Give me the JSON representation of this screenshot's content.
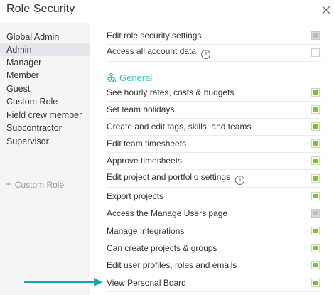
{
  "dialog": {
    "title": "Role Security",
    "close_icon": "close-icon"
  },
  "sidebar": {
    "roles": [
      {
        "label": "Global Admin",
        "active": false
      },
      {
        "label": "Admin",
        "active": true
      },
      {
        "label": "Manager",
        "active": false
      },
      {
        "label": "Member",
        "active": false
      },
      {
        "label": "Guest",
        "active": false
      },
      {
        "label": "Custom Role",
        "active": false
      },
      {
        "label": "Field crew member",
        "active": false
      },
      {
        "label": "Subcontractor",
        "active": false
      },
      {
        "label": "Supervisor",
        "active": false
      }
    ],
    "add_role_label": "Custom Role"
  },
  "main": {
    "top_permissions": [
      {
        "label": "Edit role security settings",
        "state": "disabled",
        "info": false
      },
      {
        "label": "Access all account data",
        "state": "off",
        "info": true
      }
    ],
    "section_title": "General",
    "section_icon": "hierarchy-icon",
    "general_permissions": [
      {
        "label": "See hourly rates, costs & budgets",
        "state": "on",
        "info": false
      },
      {
        "label": "Set team holidays",
        "state": "on",
        "info": false
      },
      {
        "label": "Create and edit tags, skills, and teams",
        "state": "on",
        "info": false
      },
      {
        "label": "Edit team timesheets",
        "state": "on",
        "info": false
      },
      {
        "label": "Approve timesheets",
        "state": "on",
        "info": false
      },
      {
        "label": "Edit project and portfolio settings",
        "state": "on",
        "info": true
      },
      {
        "label": "Export projects",
        "state": "on",
        "info": false
      },
      {
        "label": "Access the Manage Users page",
        "state": "disabled",
        "info": false
      },
      {
        "label": "Manage Integrations",
        "state": "on",
        "info": false
      },
      {
        "label": "Can create projects & groups",
        "state": "on",
        "info": false
      },
      {
        "label": "Edit user profiles, roles and emails",
        "state": "on",
        "info": false
      },
      {
        "label": "View Personal Board",
        "state": "on",
        "info": false
      }
    ],
    "info_glyph": "i"
  },
  "colors": {
    "accent_teal": "#3dbfbf",
    "checkbox_green": "#7cc628",
    "sidebar_bg": "#f5f5f5",
    "active_role_bg": "#e4e7ec",
    "arrow": "#1aa3a3"
  }
}
